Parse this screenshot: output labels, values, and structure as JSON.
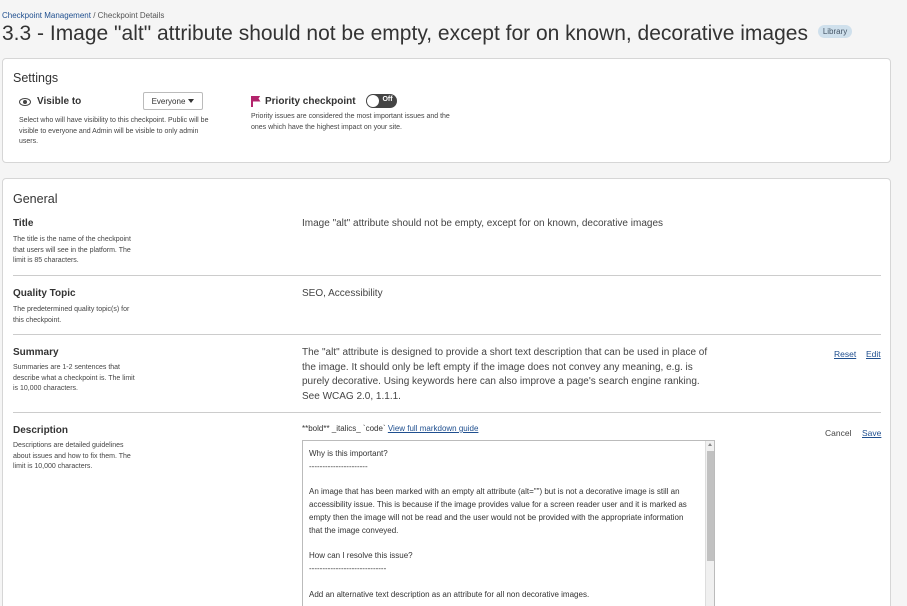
{
  "breadcrumb": {
    "parent": "Checkpoint Management",
    "separator": "/",
    "current": "Checkpoint Details"
  },
  "page": {
    "title": "3.3 - Image \"alt\" attribute should not be empty, except for on known, decorative images",
    "badge": "Library"
  },
  "settings": {
    "heading": "Settings",
    "visible_to": {
      "label": "Visible to",
      "value": "Everyone",
      "help": "Select who will have visibility to this checkpoint. Public will be visible to everyone and Admin will be visible to only admin users."
    },
    "priority": {
      "label": "Priority checkpoint",
      "toggle_state": "Off",
      "help": "Priority issues are considered the most important issues and the ones which have the highest impact on your site."
    }
  },
  "general": {
    "heading": "General",
    "title_row": {
      "label": "Title",
      "help": "The title is the name of the checkpoint that users will see in the platform. The limit is 85 characters.",
      "value": "Image \"alt\" attribute should not be empty, except for on known, decorative images"
    },
    "quality_row": {
      "label": "Quality Topic",
      "help": "The predetermined quality topic(s) for this checkpoint.",
      "value": "SEO, Accessibility"
    },
    "summary_row": {
      "label": "Summary",
      "help": "Summaries are 1-2 sentences that describe what a checkpoint is. The limit is 10,000 characters.",
      "value": "The \"alt\" attribute is designed to provide a short text description that can be used in place of the image. It should only be left empty if the image does not convey any meaning, e.g. is purely decorative. Using keywords here can also improve a page's search engine ranking. See WCAG 2.0, 1.1.1.",
      "reset": "Reset",
      "edit": "Edit"
    },
    "description_row": {
      "label": "Description",
      "help": "Descriptions are detailed guidelines about issues and how to fix them. The limit is 10,000 characters.",
      "markdown_hint": "**bold** _italics_ `code`",
      "markdown_link": "View full markdown guide",
      "cancel": "Cancel",
      "save": "Save",
      "editor_text": "Why is this important?\n----------------------\n\nAn image that has been marked with an empty alt attribute (alt=\"\") but is not a decorative image is still an accessibility issue. This is because if the image provides value for a screen reader user and it is marked as empty then the image will not be read and the user would not be provided with the appropriate information that the image conveyed.\n\nHow can I resolve this issue?\n-----------------------------\n\nAdd an alternative text description as an attribute for all non decorative images."
    }
  },
  "colors": {
    "link": "#1f4f8f",
    "flag": "#b3246c",
    "toggle_bg": "#444444",
    "badge_bg": "#cfe0ec"
  },
  "icons": {
    "visible": "eye-icon",
    "priority": "flag-icon",
    "dropdown": "chevron-down-icon"
  }
}
